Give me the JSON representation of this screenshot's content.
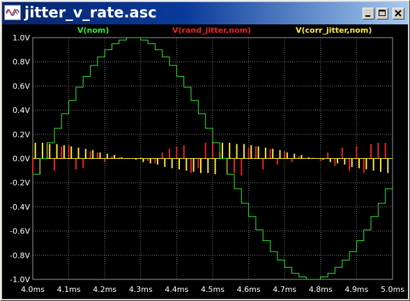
{
  "window": {
    "title": "jitter_v_rate.asc",
    "icon": "waveform-icon",
    "buttons": {
      "minimize": "minimize-icon",
      "maximize": "maximize-icon",
      "close": "close-icon"
    }
  },
  "colors": {
    "title_bar": "#0a246a",
    "plot_bg": "#000000",
    "grid": "#7a7a7a",
    "axis_text": "#ffffff",
    "nom": "#33ee33",
    "rand": "#ee2222",
    "corr": "#ffee33"
  },
  "chart_data": {
    "type": "line",
    "title": "",
    "xlabel": "",
    "ylabel": "",
    "xlim": [
      4.0,
      5.0
    ],
    "ylim": [
      -1.0,
      1.0
    ],
    "grid": true,
    "legend_position": "top",
    "x_ticks": [
      "4.0ms",
      "4.1ms",
      "4.2ms",
      "4.3ms",
      "4.4ms",
      "4.5ms",
      "4.6ms",
      "4.7ms",
      "4.8ms",
      "4.9ms",
      "5.0ms"
    ],
    "y_ticks": [
      "1.0V",
      "0.8V",
      "0.6V",
      "0.4V",
      "0.2V",
      "0.0V",
      "-0.2V",
      "-0.4V",
      "-0.6V",
      "-0.8V",
      "-1.0V"
    ],
    "series": [
      {
        "name": "V(nom)",
        "kind": "staircase",
        "x": [
          4.0,
          4.02,
          4.04,
          4.06,
          4.08,
          4.1,
          4.12,
          4.14,
          4.16,
          4.18,
          4.2,
          4.22,
          4.24,
          4.26,
          4.28,
          4.3,
          4.32,
          4.34,
          4.36,
          4.38,
          4.4,
          4.42,
          4.44,
          4.46,
          4.48,
          4.5,
          4.52,
          4.54,
          4.56,
          4.58,
          4.6,
          4.62,
          4.64,
          4.66,
          4.68,
          4.7,
          4.72,
          4.74,
          4.76,
          4.78,
          4.8,
          4.82,
          4.84,
          4.86,
          4.88,
          4.9,
          4.92,
          4.94,
          4.96,
          4.98
        ],
        "values": [
          -0.13,
          0.0,
          0.13,
          0.25,
          0.37,
          0.48,
          0.59,
          0.68,
          0.77,
          0.84,
          0.9,
          0.95,
          0.98,
          1.0,
          1.0,
          0.98,
          0.95,
          0.9,
          0.84,
          0.77,
          0.68,
          0.59,
          0.48,
          0.37,
          0.25,
          0.13,
          0.0,
          -0.13,
          -0.25,
          -0.37,
          -0.48,
          -0.59,
          -0.68,
          -0.77,
          -0.84,
          -0.9,
          -0.95,
          -0.98,
          -1.0,
          -1.0,
          -0.98,
          -0.95,
          -0.9,
          -0.84,
          -0.77,
          -0.68,
          -0.59,
          -0.48,
          -0.37,
          -0.25
        ]
      },
      {
        "name": "V(rand_jitter,nom)",
        "kind": "spikes",
        "x": [
          4.0,
          4.02,
          4.04,
          4.06,
          4.08,
          4.1,
          4.12,
          4.14,
          4.16,
          4.18,
          4.2,
          4.22,
          4.24,
          4.26,
          4.28,
          4.3,
          4.32,
          4.34,
          4.36,
          4.38,
          4.4,
          4.42,
          4.44,
          4.46,
          4.48,
          4.5,
          4.52,
          4.54,
          4.56,
          4.58,
          4.6,
          4.62,
          4.64,
          4.66,
          4.68,
          4.7,
          4.72,
          4.74,
          4.76,
          4.78,
          4.8,
          4.82,
          4.84,
          4.86,
          4.88,
          4.9,
          4.92,
          4.94,
          4.96,
          4.98
        ],
        "values": [
          -0.12,
          -0.13,
          0.12,
          -0.1,
          0.1,
          0.11,
          -0.09,
          -0.08,
          0.06,
          0.05,
          -0.03,
          0.02,
          0.01,
          0.0,
          0.0,
          0.01,
          -0.02,
          -0.04,
          0.05,
          0.08,
          0.1,
          0.11,
          -0.12,
          -0.08,
          0.13,
          0.14,
          0.05,
          -0.13,
          -0.12,
          -0.14,
          0.09,
          0.1,
          -0.09,
          0.08,
          -0.05,
          0.06,
          -0.03,
          0.02,
          0.0,
          0.01,
          -0.02,
          0.05,
          -0.06,
          0.09,
          -0.1,
          0.1,
          -0.12,
          0.12,
          0.13,
          0.13
        ]
      },
      {
        "name": "V(corr_jitter,nom)",
        "kind": "spikes",
        "x": [
          4.0,
          4.02,
          4.04,
          4.06,
          4.08,
          4.1,
          4.12,
          4.14,
          4.16,
          4.18,
          4.2,
          4.22,
          4.24,
          4.26,
          4.28,
          4.3,
          4.32,
          4.34,
          4.36,
          4.38,
          4.4,
          4.42,
          4.44,
          4.46,
          4.48,
          4.5,
          4.52,
          4.54,
          4.56,
          4.58,
          4.6,
          4.62,
          4.64,
          4.66,
          4.68,
          4.7,
          4.72,
          4.74,
          4.76,
          4.78,
          4.8,
          4.82,
          4.84,
          4.86,
          4.88,
          4.9,
          4.92,
          4.94,
          4.96,
          4.98
        ],
        "values": [
          0.13,
          0.13,
          0.12,
          0.12,
          0.11,
          0.1,
          0.09,
          0.08,
          0.07,
          0.05,
          0.04,
          0.03,
          0.01,
          0.0,
          -0.01,
          -0.03,
          -0.04,
          -0.05,
          -0.07,
          -0.08,
          -0.09,
          -0.1,
          -0.11,
          -0.12,
          -0.12,
          -0.13,
          0.13,
          0.13,
          0.12,
          0.12,
          0.11,
          0.1,
          0.09,
          0.08,
          0.07,
          0.05,
          0.04,
          0.03,
          0.01,
          0.0,
          -0.01,
          -0.03,
          -0.04,
          -0.05,
          -0.07,
          -0.08,
          -0.09,
          -0.1,
          -0.11,
          -0.12
        ]
      }
    ]
  }
}
